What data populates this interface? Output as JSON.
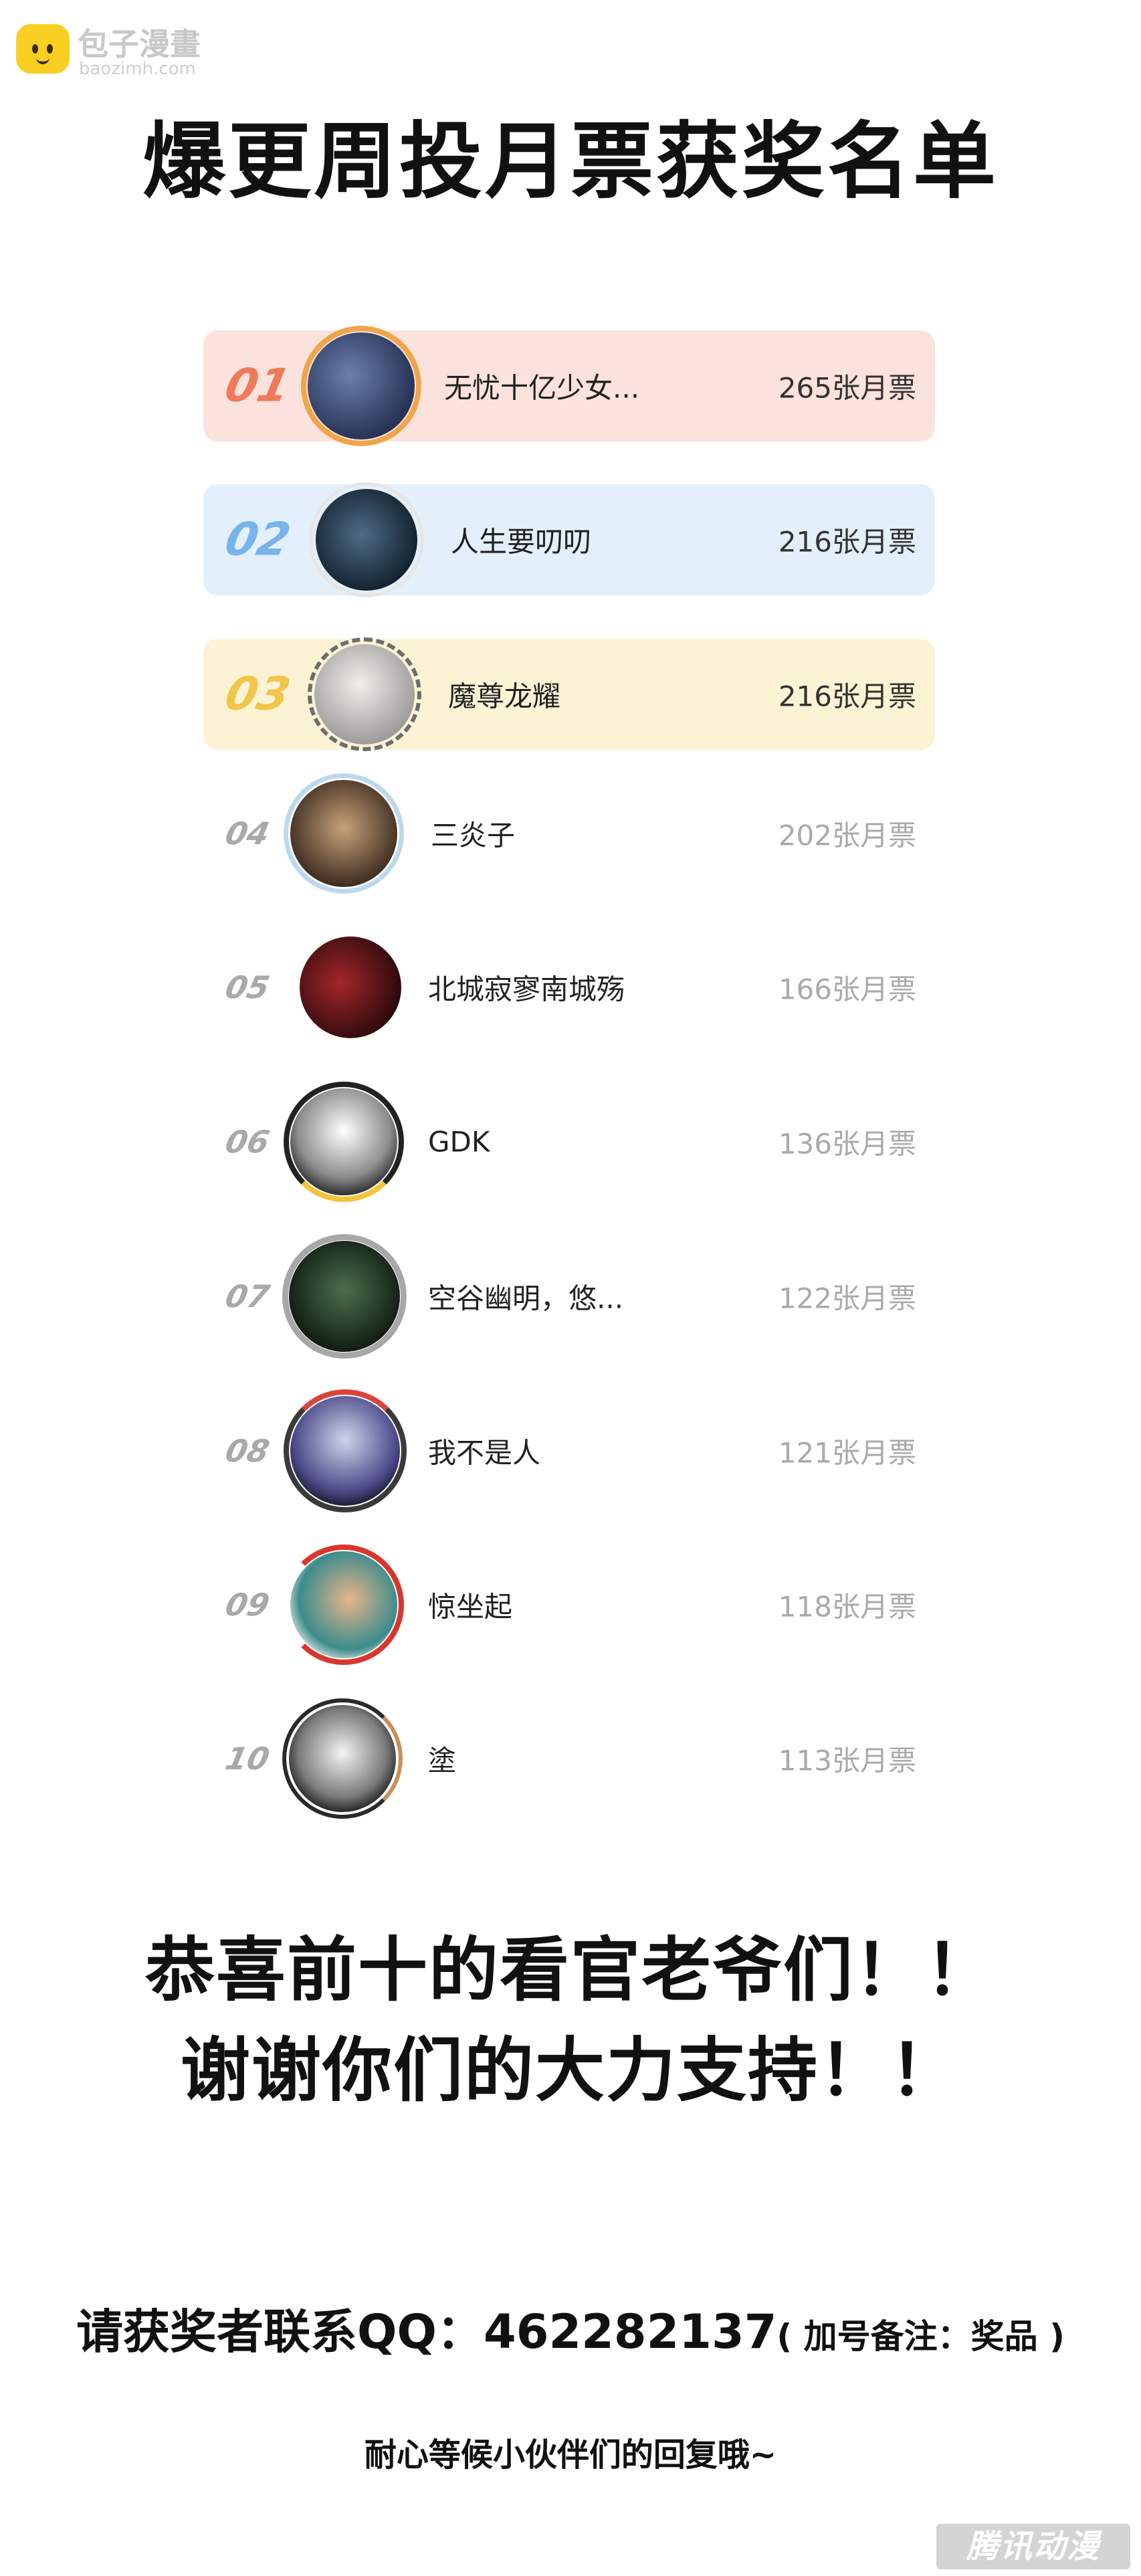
{
  "watermark": {
    "title": "包子漫畫",
    "url": "baozimh.com"
  },
  "title": "爆更周投月票获奖名单",
  "ranking": [
    {
      "rank": "01",
      "name": "无忧十亿少女...",
      "votes": "265张月票"
    },
    {
      "rank": "02",
      "name": "人生要叨叨",
      "votes": "216张月票"
    },
    {
      "rank": "03",
      "name": "魔尊龙耀",
      "votes": "216张月票"
    },
    {
      "rank": "04",
      "name": "三炎子",
      "votes": "202张月票"
    },
    {
      "rank": "05",
      "name": "北城寂寥南城殇",
      "votes": "166张月票"
    },
    {
      "rank": "06",
      "name": "GDK",
      "votes": "136张月票"
    },
    {
      "rank": "07",
      "name": "空谷幽明，悠...",
      "votes": "122张月票"
    },
    {
      "rank": "08",
      "name": "我不是人",
      "votes": "121张月票"
    },
    {
      "rank": "09",
      "name": "惊坐起",
      "votes": "118张月票"
    },
    {
      "rank": "10",
      "name": "塗",
      "votes": "113张月票"
    }
  ],
  "congrats": {
    "line1": "恭喜前十的看官老爷们！！",
    "line2": "谢谢你们的大力支持！！"
  },
  "contact": {
    "main": "请获奖者联系QQ：462282137",
    "note": "( 加号备注：奖品 )"
  },
  "closing": "耐心等候小伙伴们的回复哦~",
  "corner_watermark": "腾讯动漫",
  "colors": {
    "rank1_bg": "#fbe2dc",
    "rank1_num": "#ee7a5a",
    "rank2_bg": "#e3effb",
    "rank2_num": "#76b4ec",
    "rank3_bg": "#fcf3d5",
    "rank3_num": "#f2c64a",
    "rank_plain": "#a9a9a9",
    "logo_yellow": "#f9cf22"
  }
}
